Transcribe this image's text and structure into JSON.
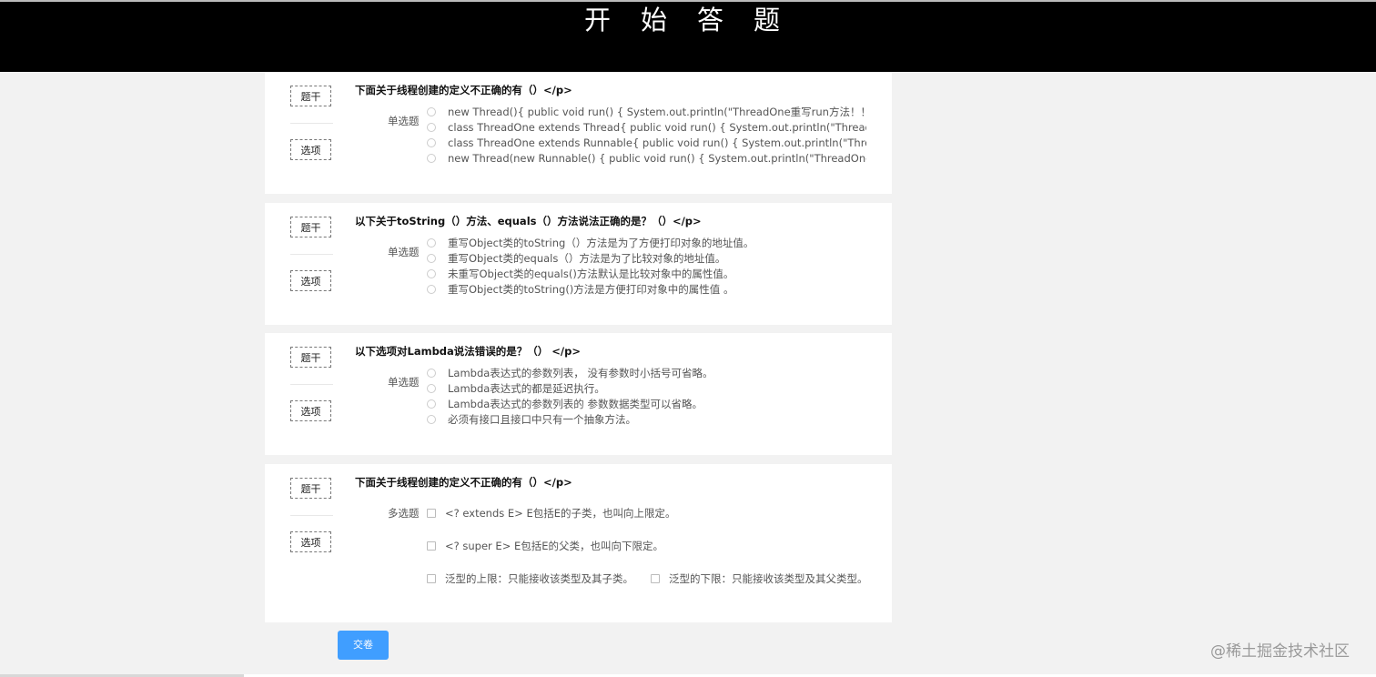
{
  "header": {
    "title": "开始答题"
  },
  "labels": {
    "stem": "题干",
    "options": "选项"
  },
  "questions": [
    {
      "title": "下面关于线程创建的定义不正确的有（）</p>",
      "type": "单选题",
      "options": [
        "new Thread(){ public void run() { System.out.println(\"ThreadOne重写run方法！！\"); } };",
        "class ThreadOne extends Thread{ public void run() { System.out.println(\"ThreadOne重写run方法！！\"); } }",
        "class ThreadOne extends Runnable{ public void run() { System.out.println(\"ThreadOne重写run方法！！\"); } }",
        "new Thread(new Runnable() { public void run() { System.out.println(\"ThreadOne重写run方法！！\"); } });"
      ]
    },
    {
      "title": "以下关于toString（）方法、equals（）方法说法正确的是？（）</p>",
      "type": "单选题",
      "options": [
        "重写Object类的toString（）方法是为了方便打印对象的地址值。",
        "重写Object类的equals（）方法是为了比较对象的地址值。",
        "未重写Object类的equals()方法默认是比较对象中的属性值。",
        "重写Object类的toString()方法是方便打印对象中的属性值 。"
      ]
    },
    {
      "title": "以下选项对Lambda说法错误的是？（）  </p>",
      "type": "单选题",
      "options": [
        "Lambda表达式的参数列表，  没有参数时小括号可省略。",
        "Lambda表达式的都是延迟执行。",
        "Lambda表达式的参数列表的 参数数据类型可以省略。",
        "必须有接口且接口中只有一个抽象方法。"
      ]
    },
    {
      "title": "下面关于线程创建的定义不正确的有（）</p>",
      "type": "多选题",
      "options": [
        "<? extends E> E包括E的子类，也叫向上限定。",
        "<? super E> E包括E的父类，也叫向下限定。",
        "泛型的上限：只能接收该类型及其子类。",
        "泛型的下限：只能接收该类型及其父类型。"
      ]
    }
  ],
  "submit_label": "交卷",
  "watermark": "@稀土掘金技术社区",
  "colors": {
    "header_bg": "#000000",
    "page_bg": "#f2f2f2",
    "card_bg": "#ffffff",
    "primary": "#409eff"
  }
}
